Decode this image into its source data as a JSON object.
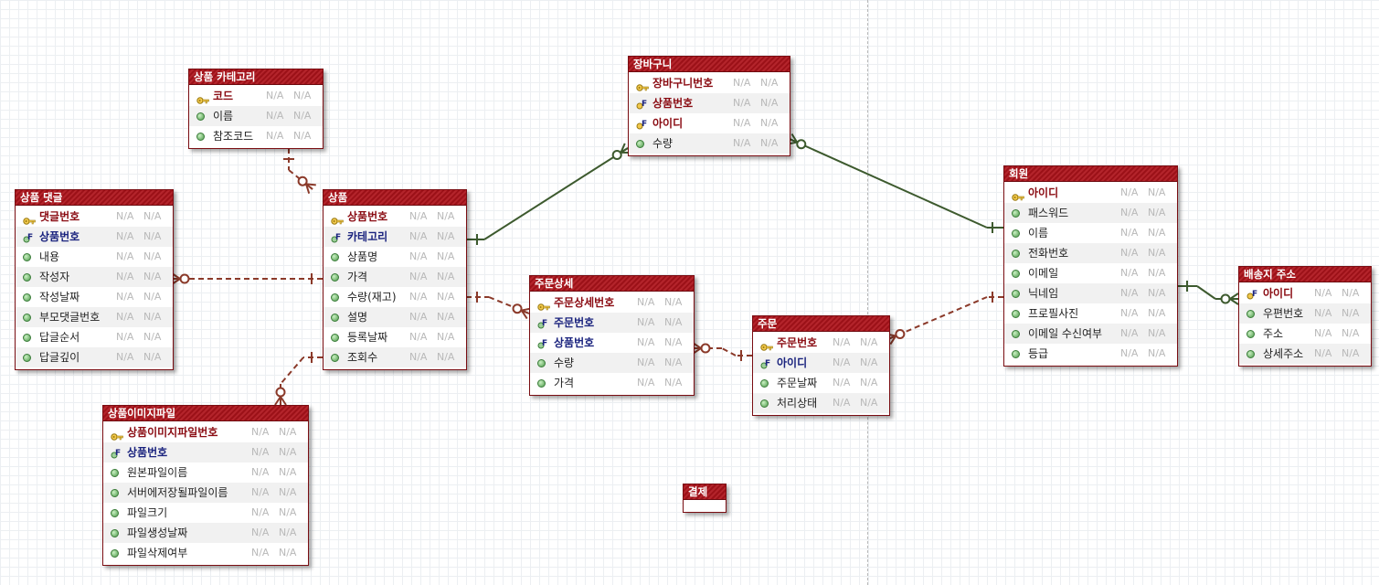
{
  "na": "N/A",
  "tables": {
    "category": {
      "title": "상품 카테고리",
      "cols": [
        {
          "name": "코드",
          "kind": "pk"
        },
        {
          "name": "이름",
          "kind": "attr"
        },
        {
          "name": "참조코드",
          "kind": "attr"
        }
      ]
    },
    "review": {
      "title": "상품 댓글",
      "cols": [
        {
          "name": "댓글번호",
          "kind": "pk"
        },
        {
          "name": "상품번호",
          "kind": "fk"
        },
        {
          "name": "내용",
          "kind": "attr"
        },
        {
          "name": "작성자",
          "kind": "attr"
        },
        {
          "name": "작성날짜",
          "kind": "attr"
        },
        {
          "name": "부모댓글번호",
          "kind": "attr"
        },
        {
          "name": "답글순서",
          "kind": "attr"
        },
        {
          "name": "답글깊이",
          "kind": "attr"
        }
      ]
    },
    "product": {
      "title": "상품",
      "cols": [
        {
          "name": "상품번호",
          "kind": "pk"
        },
        {
          "name": "카테고리",
          "kind": "fk"
        },
        {
          "name": "상품명",
          "kind": "attr"
        },
        {
          "name": "가격",
          "kind": "attr"
        },
        {
          "name": "수량(재고)",
          "kind": "attr"
        },
        {
          "name": "설명",
          "kind": "attr"
        },
        {
          "name": "등록날짜",
          "kind": "attr"
        },
        {
          "name": "조회수",
          "kind": "attr"
        }
      ]
    },
    "image": {
      "title": "상품이미지파일",
      "cols": [
        {
          "name": "상품이미지파일번호",
          "kind": "pk"
        },
        {
          "name": "상품번호",
          "kind": "fk"
        },
        {
          "name": "원본파일이름",
          "kind": "attr"
        },
        {
          "name": "서버에저장될파일이름",
          "kind": "attr"
        },
        {
          "name": "파일크기",
          "kind": "attr"
        },
        {
          "name": "파일생성날짜",
          "kind": "attr"
        },
        {
          "name": "파일삭제여부",
          "kind": "attr"
        }
      ]
    },
    "cart": {
      "title": "장바구니",
      "cols": [
        {
          "name": "장바구니번호",
          "kind": "pk"
        },
        {
          "name": "상품번호",
          "kind": "pkfk"
        },
        {
          "name": "아이디",
          "kind": "pkfk"
        },
        {
          "name": "수량",
          "kind": "attr"
        }
      ]
    },
    "orderdetail": {
      "title": "주문상세",
      "cols": [
        {
          "name": "주문상세번호",
          "kind": "pk"
        },
        {
          "name": "주문번호",
          "kind": "fk"
        },
        {
          "name": "상품번호",
          "kind": "fk"
        },
        {
          "name": "수량",
          "kind": "attr"
        },
        {
          "name": "가격",
          "kind": "attr"
        }
      ]
    },
    "order": {
      "title": "주문",
      "cols": [
        {
          "name": "주문번호",
          "kind": "pk"
        },
        {
          "name": "아이디",
          "kind": "fk"
        },
        {
          "name": "주문날짜",
          "kind": "attr"
        },
        {
          "name": "처리상태",
          "kind": "attr"
        }
      ]
    },
    "member": {
      "title": "회원",
      "cols": [
        {
          "name": "아이디",
          "kind": "pk"
        },
        {
          "name": "패스워드",
          "kind": "attr"
        },
        {
          "name": "이름",
          "kind": "attr"
        },
        {
          "name": "전화번호",
          "kind": "attr"
        },
        {
          "name": "이메일",
          "kind": "attr"
        },
        {
          "name": "닉네임",
          "kind": "attr"
        },
        {
          "name": "프로필사진",
          "kind": "attr"
        },
        {
          "name": "이메일 수신여부",
          "kind": "attr"
        },
        {
          "name": "등급",
          "kind": "attr"
        }
      ]
    },
    "shipping": {
      "title": "배송지 주소",
      "cols": [
        {
          "name": "아이디",
          "kind": "pkfk"
        },
        {
          "name": "우편번호",
          "kind": "attr"
        },
        {
          "name": "주소",
          "kind": "attr"
        },
        {
          "name": "상세주소",
          "kind": "attr"
        }
      ]
    },
    "payment": {
      "title": "결제",
      "cols": []
    }
  },
  "colors": {
    "header": "#9c1118",
    "pk_text": "#8a0b12",
    "fk_text": "#1a237e",
    "identifying_line": "#3d5a2e",
    "non_identifying_line": "#8b3a2a"
  },
  "relationships": [
    {
      "from": "category",
      "to": "product",
      "style": "dashed",
      "from_end": "one",
      "to_end": "zero-or-many"
    },
    {
      "from": "product",
      "to": "review",
      "style": "dashed",
      "from_end": "one",
      "to_end": "zero-or-many"
    },
    {
      "from": "product",
      "to": "image",
      "style": "dashed",
      "from_end": "one",
      "to_end": "zero-or-many"
    },
    {
      "from": "product",
      "to": "cart",
      "style": "solid",
      "from_end": "one",
      "to_end": "zero-or-many"
    },
    {
      "from": "member",
      "to": "cart",
      "style": "solid",
      "from_end": "one",
      "to_end": "zero-or-many"
    },
    {
      "from": "product",
      "to": "orderdetail",
      "style": "dashed",
      "from_end": "one",
      "to_end": "zero-or-many"
    },
    {
      "from": "order",
      "to": "orderdetail",
      "style": "dashed",
      "from_end": "one",
      "to_end": "zero-or-many"
    },
    {
      "from": "member",
      "to": "order",
      "style": "dashed",
      "from_end": "one",
      "to_end": "zero-or-many"
    },
    {
      "from": "member",
      "to": "shipping",
      "style": "solid",
      "from_end": "one",
      "to_end": "zero-or-many"
    }
  ]
}
